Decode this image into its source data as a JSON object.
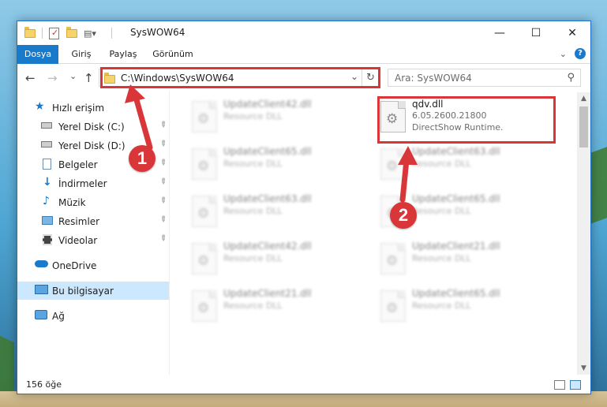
{
  "window": {
    "title": "SysWOW64",
    "minimize_glyph": "—",
    "maximize_glyph": "☐",
    "close_glyph": "✕"
  },
  "ribbon": {
    "tabs": [
      "Dosya",
      "Giriş",
      "Paylaş",
      "Görünüm"
    ],
    "help_glyph": "?"
  },
  "navigation": {
    "back_glyph": "←",
    "forward_glyph": "→",
    "recent_glyph": "⌄",
    "up_glyph": "↑",
    "address": "C:\\Windows\\SysWOW64",
    "dropdown_glyph": "⌄",
    "refresh_glyph": "↻",
    "search_placeholder": "Ara: SysWOW64",
    "search_glyph": "⚲"
  },
  "sidebar": {
    "items": [
      {
        "label": "Hızlı erişim",
        "icon": "star-icon",
        "pinned": false
      },
      {
        "label": "Yerel Disk (C:)",
        "icon": "drive-icon",
        "pinned": true
      },
      {
        "label": "Yerel Disk (D:)",
        "icon": "drive-icon",
        "pinned": true
      },
      {
        "label": "Belgeler",
        "icon": "documents-icon",
        "pinned": true
      },
      {
        "label": "İndirmeler",
        "icon": "download-icon",
        "pinned": true
      },
      {
        "label": "Müzik",
        "icon": "music-icon",
        "pinned": true
      },
      {
        "label": "Resimler",
        "icon": "pictures-icon",
        "pinned": true
      },
      {
        "label": "Videolar",
        "icon": "videos-icon",
        "pinned": true
      },
      {
        "label": "OneDrive",
        "icon": "cloud-icon",
        "pinned": false
      },
      {
        "label": "Bu bilgisayar",
        "icon": "computer-icon",
        "pinned": false,
        "selected": true
      },
      {
        "label": "Ağ",
        "icon": "network-icon",
        "pinned": false
      }
    ],
    "pin_glyph": "📌"
  },
  "files": [
    {
      "name": "UpdateClient42.dll",
      "meta1": "Resource DLL",
      "blurred": true
    },
    {
      "name": "qdv.dll",
      "meta1": "6.05.2600.21800",
      "meta2": "DirectShow Runtime.",
      "blurred": false
    },
    {
      "name": "UpdateClient65.dll",
      "meta1": "Resource DLL",
      "blurred": true
    },
    {
      "name": "UpdateClient63.dll",
      "meta1": "Resource DLL",
      "blurred": true
    },
    {
      "name": "UpdateClient63.dll",
      "meta1": "Resource DLL",
      "blurred": true
    },
    {
      "name": "UpdateClient65.dll",
      "meta1": "Resource DLL",
      "blurred": true
    },
    {
      "name": "UpdateClient42.dll",
      "meta1": "Resource DLL",
      "blurred": true
    },
    {
      "name": "UpdateClient21.dll",
      "meta1": "Resource DLL",
      "blurred": true
    },
    {
      "name": "UpdateClient21.dll",
      "meta1": "Resource DLL",
      "blurred": true
    },
    {
      "name": "UpdateClient65.dll",
      "meta1": "Resource DLL",
      "blurred": true
    }
  ],
  "status": {
    "item_count": "156 öğe"
  },
  "annotations": {
    "step1": "1",
    "step2": "2",
    "color": "#d9363a"
  },
  "scrollbar": {
    "up_glyph": "▲",
    "down_glyph": "▼"
  }
}
